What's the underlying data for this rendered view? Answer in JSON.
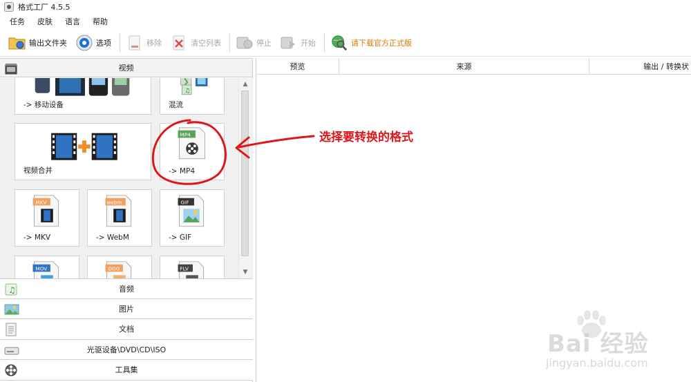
{
  "window": {
    "title": "格式工厂 4.5.5"
  },
  "menu": {
    "items": [
      "任务",
      "皮肤",
      "语言",
      "帮助"
    ]
  },
  "toolbar": {
    "output_folder": "输出文件夹",
    "options": "选项",
    "remove": "移除",
    "clear_list": "清空列表",
    "stop": "停止",
    "start": "开始",
    "download": "请下载官方正式版"
  },
  "left": {
    "video_header": "视频",
    "tiles": {
      "mobile": "-> 移动设备",
      "mix": "混流",
      "merge": "视频合并",
      "mp4": "-> MP4",
      "mkv": "-> MKV",
      "webm": "-> WebM",
      "gif": "-> GIF"
    },
    "badges": {
      "mp4": "MP4",
      "mkv": "MKV",
      "webm": "webm",
      "gif": "GIF",
      "mov": "MOV",
      "ogg": "OGG",
      "flv": "FLV"
    },
    "sections": [
      "音频",
      "图片",
      "文档",
      "光驱设备\\DVD\\CD\\ISO",
      "工具集"
    ]
  },
  "right": {
    "columns": [
      "预览",
      "来源",
      "输出 / 转换状"
    ]
  },
  "annotation": {
    "text": "选择要转换的格式",
    "color": "#e0151b"
  },
  "watermark": {
    "brand": "Bai 经验",
    "url": "jingyan.baidu.com"
  }
}
